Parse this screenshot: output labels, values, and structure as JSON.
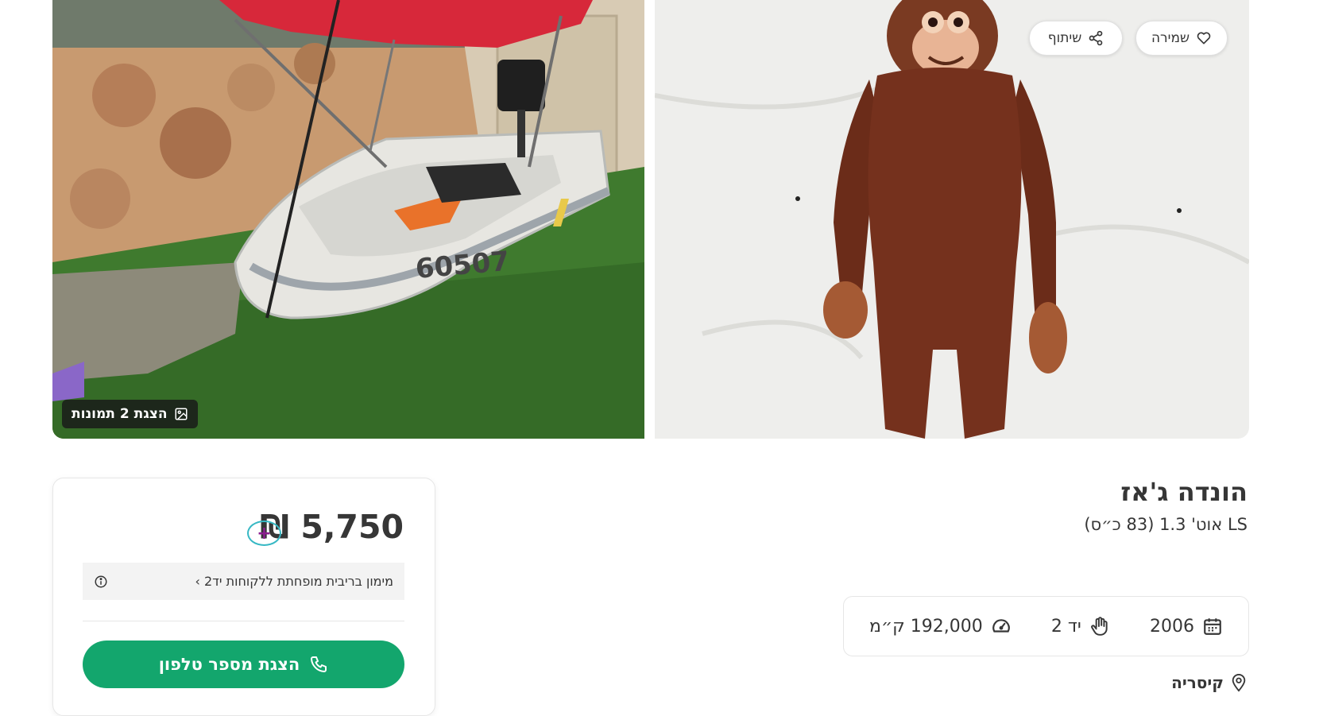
{
  "gallery": {
    "actions": {
      "save_label": "שמירה",
      "share_label": "שיתוף"
    },
    "show_photos_label": "הצגת 2 תמונות",
    "left_image": "inflatable-boat-photo",
    "right_image": "plush-monkey-photo"
  },
  "listing": {
    "title": "הונדה ג'אז",
    "subtitle": "LS אוט' 1.3 (83 כ״ס)",
    "specs": {
      "year": "2006",
      "hand": "יד 2",
      "mileage": "192,000 ק״מ"
    },
    "location": "קיסריה"
  },
  "price_card": {
    "price": "5,750 ₪",
    "plus_symbol": "+",
    "financing_text": "מימון בריבית מופחתת ללקוחות יד2 ›",
    "phone_button_label": "הצגת מספר טלפון"
  },
  "colors": {
    "primary_green": "#13a66d",
    "plus_ring": "#36b8c4",
    "plus_sign": "#8a1d8f",
    "text": "#363636"
  },
  "icons": [
    "heart-icon",
    "share-icon",
    "image-icon",
    "calendar-icon",
    "hand-icon",
    "speedometer-icon",
    "location-pin-icon",
    "info-icon",
    "phone-icon"
  ]
}
